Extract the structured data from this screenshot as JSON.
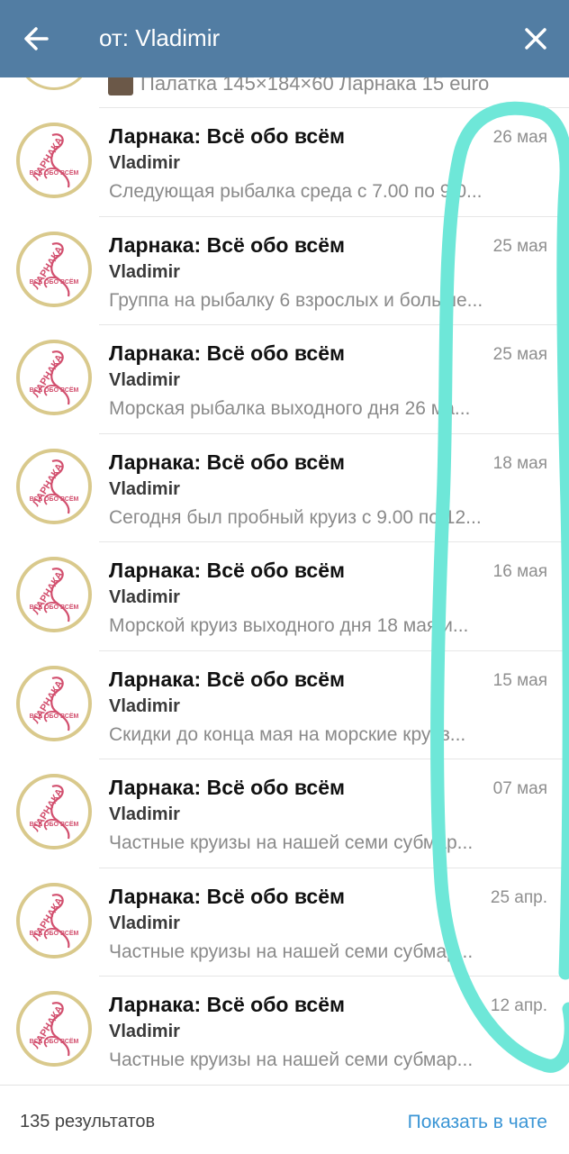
{
  "header": {
    "search_text": "от: Vladimir",
    "background_color": "#527da3",
    "back_icon": "arrow-left-icon",
    "close_icon": "close-icon"
  },
  "partial_row": {
    "text": "Палатка 145×184×60 Ларнака 15 euro"
  },
  "results": [
    {
      "title": "Ларнака: Всё обо всём",
      "sender": "Vladimir",
      "date": "26 мая",
      "preview": "Следующая рыбалка среда с 7.00 по 9.0..."
    },
    {
      "title": "Ларнака: Всё обо всём",
      "sender": "Vladimir",
      "date": "25 мая",
      "preview": "Группа на рыбалку 6 взрослых и больше..."
    },
    {
      "title": "Ларнака: Всё обо всём",
      "sender": "Vladimir",
      "date": "25 мая",
      "preview": "Морская рыбалка выходного дня  26 ма..."
    },
    {
      "title": "Ларнака: Всё обо всём",
      "sender": "Vladimir",
      "date": "18 мая",
      "preview": "Сегодня был пробный круиз с 9.00 по 12..."
    },
    {
      "title": "Ларнака: Всё обо всём",
      "sender": "Vladimir",
      "date": "16 мая",
      "preview": "Морской круиз  выходного дня 18 мая и..."
    },
    {
      "title": "Ларнака: Всё обо всём",
      "sender": "Vladimir",
      "date": "15 мая",
      "preview": "Скидки до конца мая на морские круиз..."
    },
    {
      "title": "Ларнака: Всё обо всём",
      "sender": "Vladimir",
      "date": "07 мая",
      "preview": "Частные круизы на нашей семи субмар..."
    },
    {
      "title": "Ларнака: Всё обо всём",
      "sender": "Vladimir",
      "date": "25 апр.",
      "preview": "Частные круизы на нашей семи субмар..."
    },
    {
      "title": "Ларнака: Всё обо всём",
      "sender": "Vladimir",
      "date": "12 апр.",
      "preview": "Частные круизы на нашей семи субмар..."
    }
  ],
  "avatar": {
    "logo_text": "ЛАРНАКА",
    "logo_subtext": "ВСЁ ОБО ВСЁМ",
    "ring_color": "#d9c98c",
    "logo_color": "#d24f6e"
  },
  "footer": {
    "results_count": "135 результатов",
    "show_in_chat": "Показать в чате",
    "link_color": "#3a95d5"
  },
  "annotation_color": "#6ee7d8"
}
